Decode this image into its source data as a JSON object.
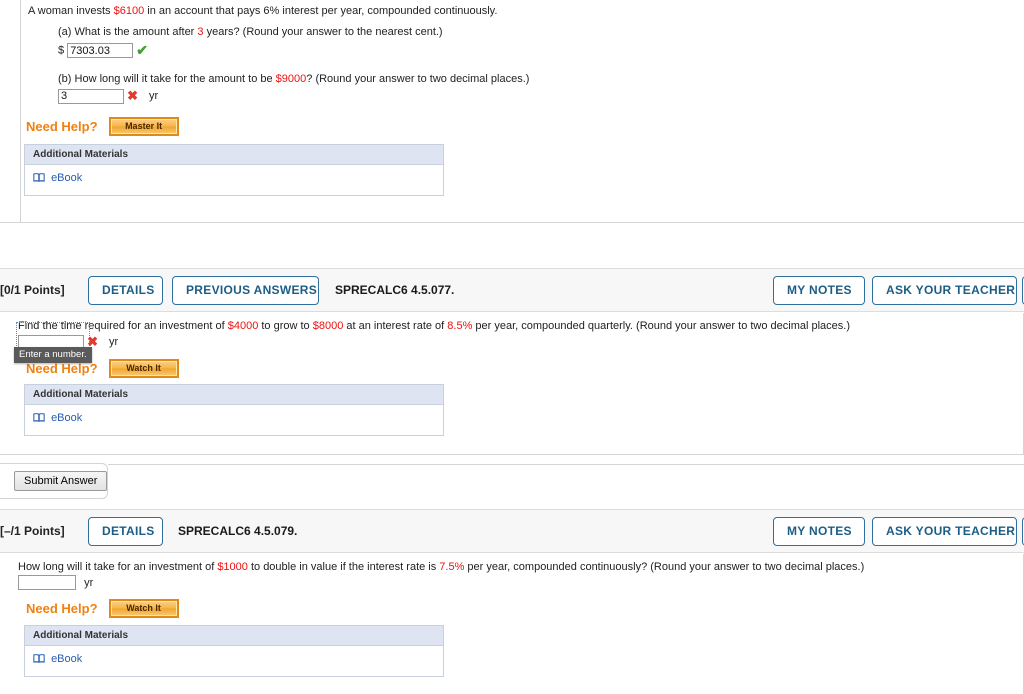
{
  "questions": [
    {
      "id": "q1",
      "stem_prefix": "A woman invests ",
      "stem_value": "$6100",
      "stem_suffix": " in an account that pays 6% interest per year, compounded continuously.",
      "parts": [
        {
          "label": "(a)",
          "text_before": " What is the amount after ",
          "value": "3",
          "text_after": " years? (Round your answer to the nearest cent.)",
          "prefix_symbol": "$",
          "answer": "7303.03",
          "status_icon": "checkmark-icon",
          "status": "correct",
          "unit": ""
        },
        {
          "label": "(b)",
          "text_before": " How long will it take for the amount to be ",
          "value": "$9000",
          "text_after": "? (Round your answer to two decimal places.)",
          "prefix_symbol": "",
          "answer": "3",
          "status_icon": "cross-icon",
          "status": "incorrect",
          "unit": "yr"
        }
      ],
      "need_help_label": "Need Help?",
      "help_button_label": "Master It",
      "materials_header": "Additional Materials",
      "materials_link": "eBook"
    },
    {
      "id": "q2",
      "points": "[0/1 Points]",
      "buttons": [
        "DETAILS",
        "PREVIOUS ANSWERS"
      ],
      "code": "SPRECALC6 4.5.077.",
      "right_buttons": [
        "MY NOTES",
        "ASK YOUR TEACHER"
      ],
      "stem_segments": [
        {
          "text": "Find the time required for an investment of ",
          "kind": "plain"
        },
        {
          "text": "$4000",
          "kind": "value"
        },
        {
          "text": " to grow to ",
          "kind": "plain"
        },
        {
          "text": "$8000",
          "kind": "value"
        },
        {
          "text": " at an interest rate of ",
          "kind": "plain"
        },
        {
          "text": "8.5%",
          "kind": "value"
        },
        {
          "text": " per year, compounded quarterly. (Round your answer to two decimal places.)",
          "kind": "plain"
        }
      ],
      "answer": "",
      "status_icon": "cross-icon",
      "unit": "yr",
      "tooltip": "Enter a number.",
      "need_help_label": "Need Help?",
      "help_button_label": "Watch It",
      "materials_header": "Additional Materials",
      "materials_link": "eBook",
      "submit_label": "Submit Answer"
    },
    {
      "id": "q3",
      "points": "[–/1 Points]",
      "buttons": [
        "DETAILS"
      ],
      "code": "SPRECALC6 4.5.079.",
      "right_buttons": [
        "MY NOTES",
        "ASK YOUR TEACHER"
      ],
      "stem_segments": [
        {
          "text": "How long will it take for an investment of ",
          "kind": "plain"
        },
        {
          "text": "$1000",
          "kind": "value"
        },
        {
          "text": " to double in value if the interest rate is ",
          "kind": "plain"
        },
        {
          "text": "7.5%",
          "kind": "value"
        },
        {
          "text": " per year, compounded continuously? (Round your answer to two decimal places.)",
          "kind": "plain"
        }
      ],
      "answer": "",
      "unit": "yr",
      "need_help_label": "Need Help?",
      "help_button_label": "Watch It",
      "materials_header": "Additional Materials",
      "materials_link": "eBook"
    }
  ],
  "colors": {
    "value_red": "#ee1111",
    "help_orange": "#f08010",
    "link_blue": "#2a5db0",
    "button_blue": "#1c5d86",
    "correct_green": "#41a02c",
    "incorrect_red": "#e03b2f"
  }
}
